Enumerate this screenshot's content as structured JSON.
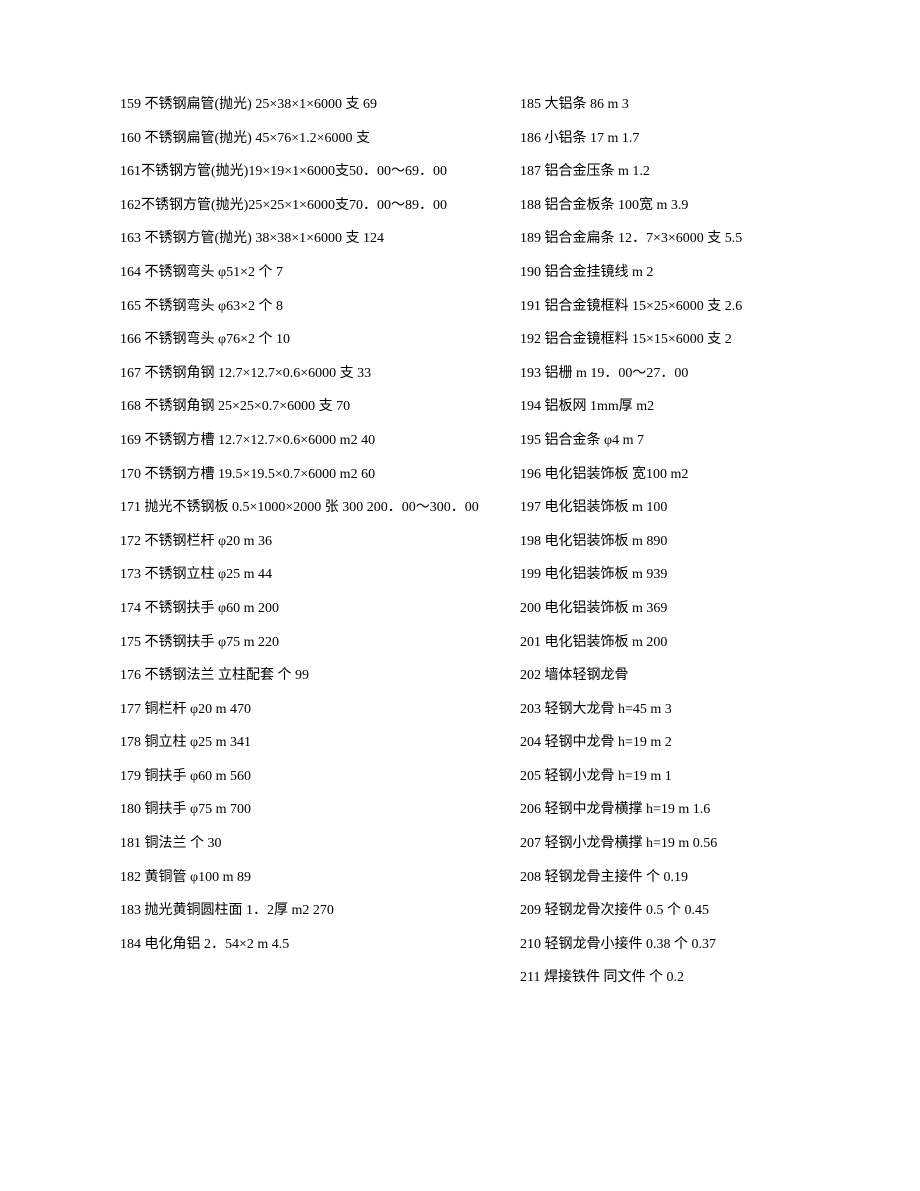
{
  "columns": {
    "left": [
      "159 不锈钢扁管(抛光) 25×38×1×6000 支 69",
      "160 不锈钢扁管(抛光) 45×76×1.2×6000 支",
      "161不锈钢方管(抛光)19×19×1×6000支50．00～69．00",
      "162不锈钢方管(抛光)25×25×1×6000支70．00～89．00",
      "163 不锈钢方管(抛光) 38×38×1×6000 支 124",
      "164 不锈钢弯头 φ51×2 个 7",
      "165 不锈钢弯头 φ63×2 个 8",
      "166 不锈钢弯头 φ76×2 个 10",
      "167 不锈钢角钢 12.7×12.7×0.6×6000 支 33",
      "168 不锈钢角钢 25×25×0.7×6000 支 70",
      "169 不锈钢方槽 12.7×12.7×0.6×6000 m2 40",
      "170 不锈钢方槽 19.5×19.5×0.7×6000 m2 60",
      "171 抛光不锈钢板 0.5×1000×2000 张 300 200．00～300．00",
      "172 不锈钢栏杆 φ20 m 36",
      "173 不锈钢立柱 φ25 m 44",
      "174 不锈钢扶手 φ60 m 200",
      "175 不锈钢扶手 φ75 m 220",
      "176 不锈钢法兰 立柱配套 个 99",
      "177 铜栏杆 φ20 m 470",
      "178 铜立柱 φ25 m 341",
      "179 铜扶手 φ60 m 560",
      "180 铜扶手 φ75 m 700",
      "181 铜法兰 个 30",
      "182 黄铜管 φ100 m 89",
      "183 抛光黄铜圆柱面 1．2厚 m2 270",
      "184 电化角铝 2．54×2 m 4.5"
    ],
    "right": [
      "185 大铝条 86 m 3",
      "186 小铝条 17 m 1.7",
      "187 铝合金压条 m 1.2",
      "188 铝合金板条 100宽 m 3.9",
      "189 铝合金扁条 12．7×3×6000 支 5.5",
      "190 铝合金挂镜线 m 2",
      "191 铝合金镜框料 15×25×6000 支 2.6",
      "192 铝合金镜框料 15×15×6000 支 2",
      "193 铝栅 m 19．00～27．00",
      "194 铝板网 1mm厚 m2",
      "195 铝合金条 φ4 m 7",
      "196 电化铝装饰板 宽100 m2",
      "197 电化铝装饰板 m 100",
      "198 电化铝装饰板 m 890",
      "199 电化铝装饰板 m 939",
      "200 电化铝装饰板 m 369",
      "201 电化铝装饰板 m 200",
      "202 墙体轻钢龙骨",
      "203 轻钢大龙骨 h=45 m 3",
      "204 轻钢中龙骨 h=19 m 2",
      "205 轻钢小龙骨 h=19 m 1",
      "206 轻钢中龙骨横撑 h=19 m 1.6",
      "207 轻钢小龙骨横撑 h=19 m 0.56",
      "208 轻钢龙骨主接件 个 0.19",
      "209 轻钢龙骨次接件 0.5 个 0.45",
      "210 轻钢龙骨小接件 0.38 个 0.37",
      "211 焊接铁件 同文件 个 0.2"
    ]
  }
}
